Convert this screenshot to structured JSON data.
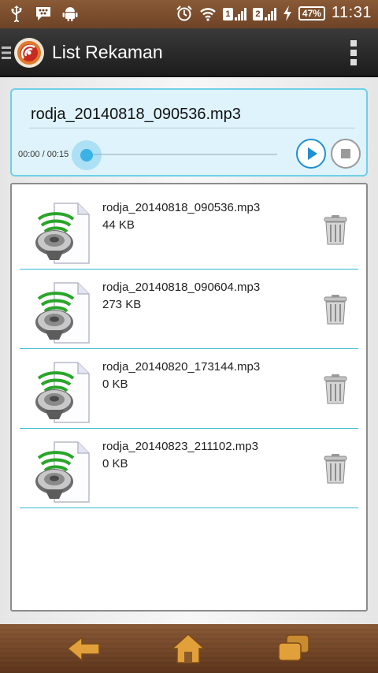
{
  "status_bar": {
    "battery": "47%",
    "time": "11:31",
    "sim1": "1",
    "sim2": "2"
  },
  "action_bar": {
    "title": "List Rekaman"
  },
  "player": {
    "file_name": "rodja_20140818_090536.mp3",
    "time_label": "00:00 / 00:15",
    "progress": 0.0
  },
  "recordings": [
    {
      "name": "rodja_20140818_090536.mp3",
      "size": "44 KB"
    },
    {
      "name": "rodja_20140818_090604.mp3",
      "size": "273 KB"
    },
    {
      "name": "rodja_20140820_173144.mp3",
      "size": "0 KB"
    },
    {
      "name": "rodja_20140823_211102.mp3",
      "size": "0 KB"
    }
  ],
  "icons": {
    "status_left": [
      "usb-icon",
      "bbm-icon",
      "android-icon"
    ],
    "status_right": [
      "alarm-icon",
      "wifi-icon",
      "signal-icon",
      "charging-icon"
    ],
    "player": [
      "play-icon",
      "stop-icon"
    ],
    "list_item": [
      "audio-file-icon",
      "trash-icon"
    ],
    "nav": [
      "back-icon",
      "home-icon",
      "recent-apps-icon"
    ]
  },
  "colors": {
    "accent": "#34b8d4",
    "player_bg": "#def3fb",
    "play_button": "#1f8fd1",
    "action_bar": "#2a2a2a",
    "wood": "#6e4326"
  }
}
